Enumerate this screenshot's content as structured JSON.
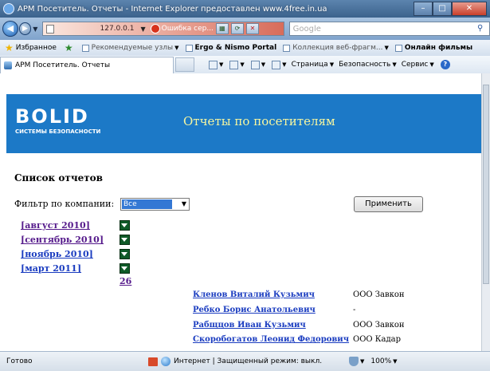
{
  "window": {
    "title": "АРМ Посетитель. Отчеты - Internet Explorer предоставлен www.4free.in.ua",
    "minimize": "–",
    "maximize": "□",
    "close": "✕"
  },
  "address_bar": {
    "url": "127.0.0.1",
    "cert_error": "Ошибка сер...",
    "search_placeholder": "Google"
  },
  "favorites_bar": {
    "favorites_label": "Избранное",
    "links": [
      {
        "label": "Рекомендуемые узлы"
      },
      {
        "label": "Ergo & Nismo Portal"
      },
      {
        "label": "Коллекция веб-фрагм..."
      },
      {
        "label": "Онлайн фильмы"
      }
    ]
  },
  "command_bar": {
    "tab_title": "АРМ Посетитель. Отчеты",
    "page_menu": "Страница",
    "safety_menu": "Безопасность",
    "tools_menu": "Сервис"
  },
  "banner": {
    "logo_text": "BOLID",
    "logo_tagline": "СИСТЕМЫ БЕЗОПАСНОСТИ",
    "title": "Отчеты по посетителям",
    "background": "#1c79c7",
    "title_color": "#f6f6a0"
  },
  "reports": {
    "heading": "Список отчетов",
    "filter_label": "Фильтр по компании:",
    "filter_value": "Все",
    "apply_button": "Применить",
    "months": [
      "[август 2010]",
      "[сентябрь 2010]",
      "[ноябрь 2010]",
      "[март 2011]"
    ],
    "page_link": "26"
  },
  "visitors": [
    {
      "name": "Кленов Виталий Кузьмич",
      "company": "ООО Завкон"
    },
    {
      "name": "Ребко Борис Анатольевич",
      "company": "-"
    },
    {
      "name": "Рабщцов Иван Кузьмич",
      "company": "ООО Завкон"
    },
    {
      "name": "Скоробогатов Леонид Федорович",
      "company": "ООО Кадар"
    }
  ],
  "status_bar": {
    "status": "Готово",
    "zone": "Интернет | Защищенный режим: выкл.",
    "zoom": "100%"
  },
  "icons": {
    "back": "back-arrow-icon",
    "forward": "forward-arrow-icon",
    "download": "download-icon",
    "favorites": "star-icon"
  }
}
